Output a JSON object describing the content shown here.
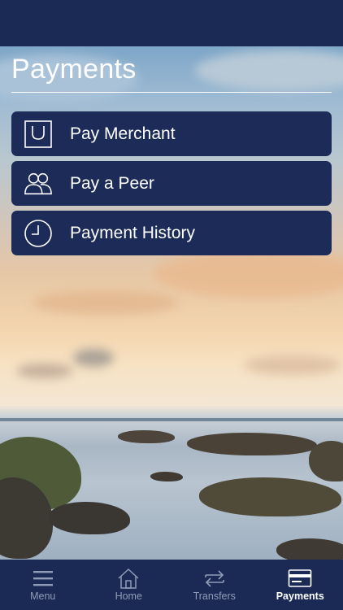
{
  "page": {
    "title": "Payments"
  },
  "actions": [
    {
      "label": "Pay Merchant",
      "icon": "shopping-bag-icon"
    },
    {
      "label": "Pay a Peer",
      "icon": "people-icon"
    },
    {
      "label": "Payment History",
      "icon": "clock-icon"
    }
  ],
  "tabbar": {
    "tabs": [
      {
        "label": "Menu",
        "icon": "hamburger-menu-icon"
      },
      {
        "label": "Home",
        "icon": "home-icon"
      },
      {
        "label": "Transfers",
        "icon": "transfer-arrows-icon"
      },
      {
        "label": "Payments",
        "icon": "card-icon",
        "active": true
      }
    ]
  },
  "colors": {
    "primary": "#1c2b58",
    "inactive_tab": "#8f9cb8",
    "text": "#ffffff"
  }
}
